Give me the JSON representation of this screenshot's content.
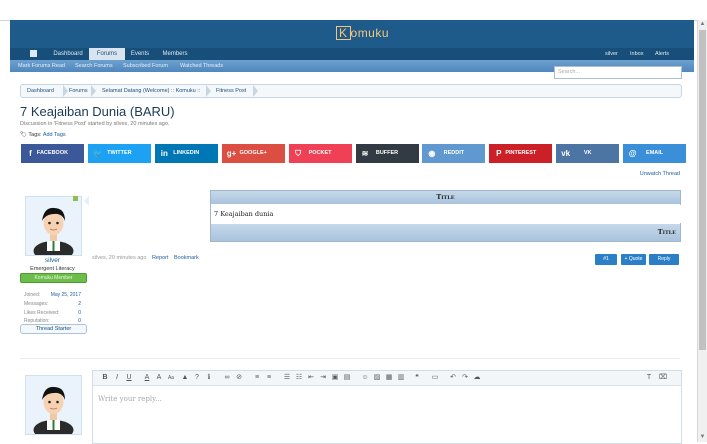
{
  "brand": {
    "logo_k": "K",
    "logo_rest": "omuku"
  },
  "nav": {
    "tabs": [
      {
        "label": "Dashboard"
      },
      {
        "label": "Forums"
      },
      {
        "label": "Events"
      },
      {
        "label": "Members"
      }
    ],
    "right": {
      "user": "silver",
      "inbox": "Inbox",
      "alerts": "Alerts"
    }
  },
  "subnav": {
    "items": [
      "Mark Forums Read",
      "Search Forums",
      "Subscribed Forum",
      "Watched Threads"
    ]
  },
  "search": {
    "placeholder": "Search..."
  },
  "breadcrumb": {
    "items": [
      "Dashboard",
      "Forums",
      "Selamat Datang (Welcome) :: Komuku ::",
      "Fitness Post"
    ]
  },
  "thread": {
    "title": "7 Keajaiban Dunia (BARU)",
    "meta": "Discussion in 'Fitness Post' started by silves, 20 minutes ago.",
    "tags_label": "Tags:",
    "add_tags": "Add Tags",
    "unwatch": "Unwatch Thread"
  },
  "share_buttons": [
    {
      "label": "FACEBOOK",
      "icon": "facebook-icon",
      "glyph": "f",
      "color": "#3b5998"
    },
    {
      "label": "TWITTER",
      "icon": "twitter-icon",
      "glyph": "🐦",
      "color": "#1da1f2"
    },
    {
      "label": "LINKEDIN",
      "icon": "linkedin-icon",
      "glyph": "in",
      "color": "#0077b5"
    },
    {
      "label": "GOOGLE+",
      "icon": "google-plus-icon",
      "glyph": "g+",
      "color": "#dc4e41"
    },
    {
      "label": "POCKET",
      "icon": "pocket-icon",
      "glyph": "⛉",
      "color": "#ef4056"
    },
    {
      "label": "BUFFER",
      "icon": "buffer-icon",
      "glyph": "≋",
      "color": "#323b43"
    },
    {
      "label": "REDDIT",
      "icon": "reddit-icon",
      "glyph": "◉",
      "color": "#5f99cf"
    },
    {
      "label": "PINTEREST",
      "icon": "pinterest-icon",
      "glyph": "P",
      "color": "#cb2027"
    },
    {
      "label": "VK",
      "icon": "vk-icon",
      "glyph": "vk",
      "color": "#4c75a3"
    },
    {
      "label": "EMAIL",
      "icon": "email-icon",
      "glyph": "@",
      "color": "#3a8fd8"
    }
  ],
  "user": {
    "name": "silver",
    "title": "Emergent Literacy",
    "banner": "Komuku Member",
    "stats": [
      {
        "label": "Joined:",
        "value": "May 25, 2017"
      },
      {
        "label": "Messages:",
        "value": "2"
      },
      {
        "label": "Likes Received:",
        "value": "0"
      },
      {
        "label": "Reputation:",
        "value": "0"
      }
    ],
    "starter": "Thread Starter"
  },
  "post": {
    "table_header": "Title",
    "table_cell": "7 Keajaiban dunia",
    "table_footer": "Title",
    "meta": "silves, 20 minutes ago",
    "report": "Report",
    "bookmark": "Bookmark",
    "buttons": {
      "number": "#1",
      "quote": "+ Quote",
      "reply": "Reply"
    }
  },
  "editor": {
    "placeholder": "Write your reply..."
  },
  "colors": {
    "header": "#1e5a8a",
    "nav": "#174e7a",
    "link": "#1b5f9c",
    "button": "#2a7fc6"
  }
}
